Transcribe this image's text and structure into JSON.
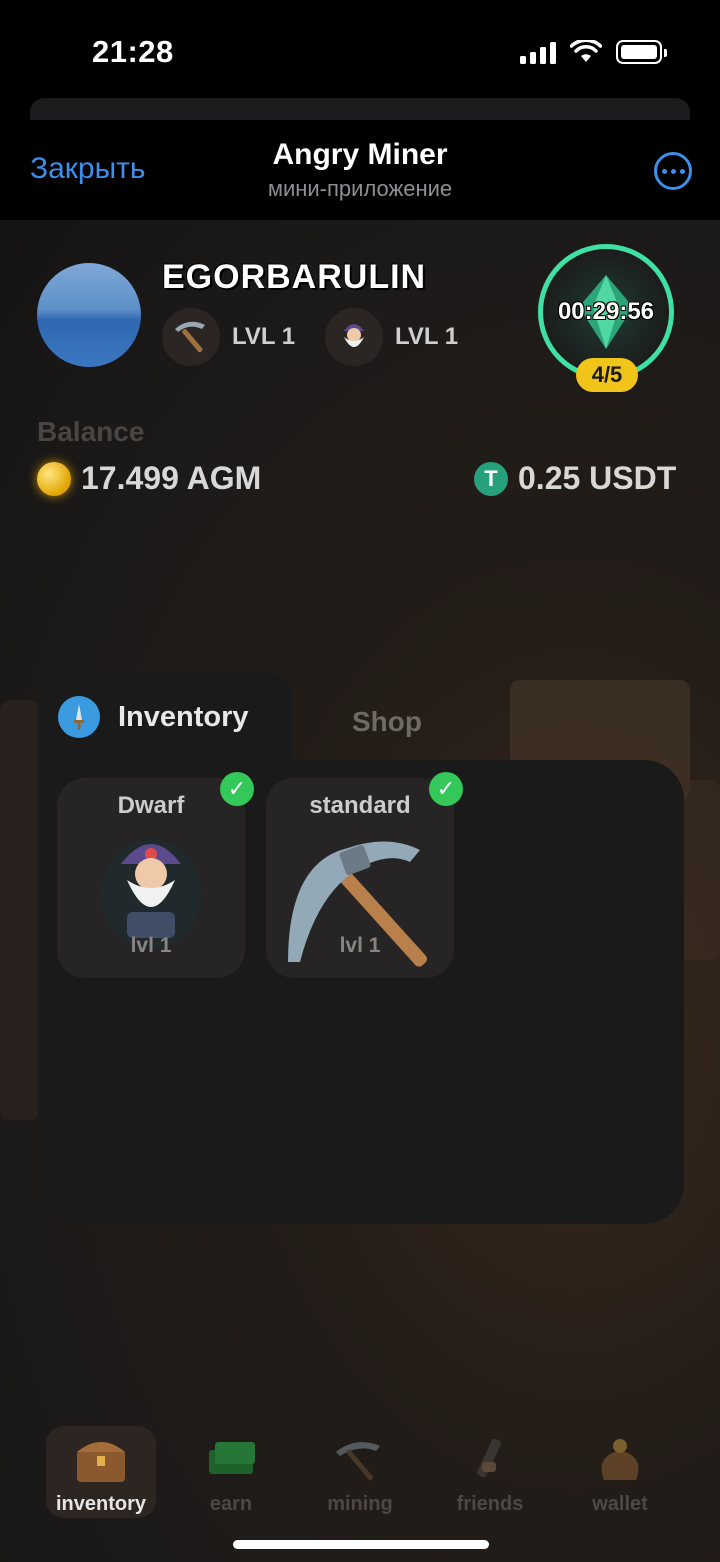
{
  "status_bar": {
    "time": "21:28",
    "signal_icon": "signal-icon",
    "wifi_icon": "wifi-icon",
    "battery_icon": "battery-icon"
  },
  "header": {
    "close_label": "Закрыть",
    "title": "Angry Miner",
    "subtitle": "мини-приложение",
    "more_icon": "ellipsis-icon"
  },
  "profile": {
    "username": "EGORBARULIN",
    "pickaxe_level": "LVL 1",
    "dwarf_level": "LVL 1",
    "timer": "00:29:56",
    "energy": "4/5"
  },
  "balance": {
    "label": "Balance",
    "agm": "17.499 AGM",
    "usdt": "0.25 USDT"
  },
  "tabs": {
    "inventory": "Inventory",
    "shop": "Shop"
  },
  "inventory": [
    {
      "name": "Dwarf",
      "level": "lvl 1",
      "equipped": true
    },
    {
      "name": "standard",
      "level": "lvl 1",
      "equipped": true
    }
  ],
  "nav": [
    {
      "label": "inventory",
      "icon": "chest-icon",
      "active": true
    },
    {
      "label": "earn",
      "icon": "money-icon",
      "active": false
    },
    {
      "label": "mining",
      "icon": "pickaxe-icon",
      "active": false
    },
    {
      "label": "friends",
      "icon": "handshake-icon",
      "active": false
    },
    {
      "label": "wallet",
      "icon": "money-bag-icon",
      "active": false
    }
  ],
  "colors": {
    "accent_blue": "#3e8eea",
    "timer_ring": "#3ee0a4",
    "energy_badge": "#f0c419",
    "check_green": "#34c759",
    "usdt_green": "#26a17b"
  }
}
